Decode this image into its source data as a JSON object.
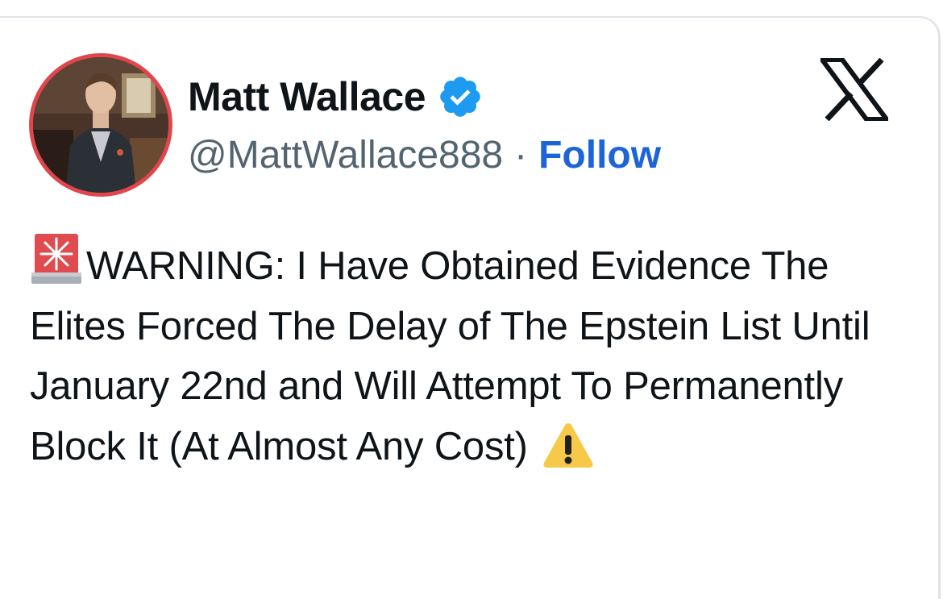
{
  "post": {
    "author_name": "Matt Wallace",
    "handle": "@MattWallace888",
    "separator": "·",
    "follow_label": "Follow",
    "text": "WARNING: I Have Obtained Evidence The Elites Forced The Delay of The Epstein List Until January 22nd and Will Attempt To Permanently Block It (At Almost Any Cost)",
    "leading_emoji": "rotating-light-icon",
    "trailing_emoji": "warning-icon"
  },
  "platform": {
    "logo": "x-logo-icon"
  },
  "colors": {
    "follow": "#1d64d8",
    "handle": "#536471",
    "verified": "#1d9bf0",
    "avatar_ring": "#e0464b"
  }
}
